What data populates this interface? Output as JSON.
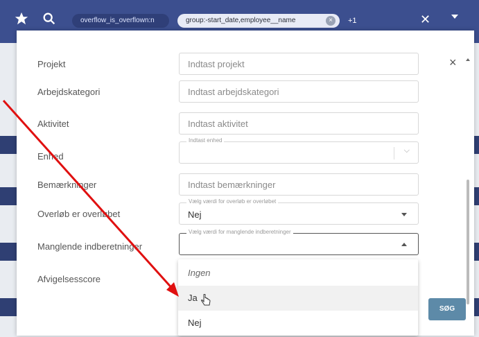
{
  "topbar": {
    "chip1": "overflow_is_overflown:n",
    "chip2": "group:-start_date,employee__name",
    "chip2_clear_icon": "close-circle-icon",
    "more_count": "+1"
  },
  "form": {
    "rows": [
      {
        "label": "Projekt",
        "placeholder": "Indtast projekt"
      },
      {
        "label": "Arbejdskategori",
        "placeholder": "Indtast arbejdskategori"
      },
      {
        "label": "Aktivitet",
        "placeholder": "Indtast aktivitet"
      },
      {
        "label": "Enhed",
        "floating_label": "Indtast enhed"
      },
      {
        "label": "Bemærkninger",
        "placeholder": "Indtast bemærkninger"
      },
      {
        "label": "Overløb er overløbet",
        "floating_label": "Vælg værdi for overløb er overløbet",
        "value": "Nej"
      },
      {
        "label": "Manglende indberetninger",
        "floating_label": "Vælg værdi for manglende indberetninger"
      },
      {
        "label": "Afvigelsesscore"
      }
    ]
  },
  "dropdown": {
    "options": [
      "Ingen",
      "Ja",
      "Nej"
    ]
  },
  "search_button": "SØG",
  "colors": {
    "topbar": "#3c4f8f",
    "annotation_arrow": "#e01010",
    "search_button": "#5d8aa8"
  }
}
